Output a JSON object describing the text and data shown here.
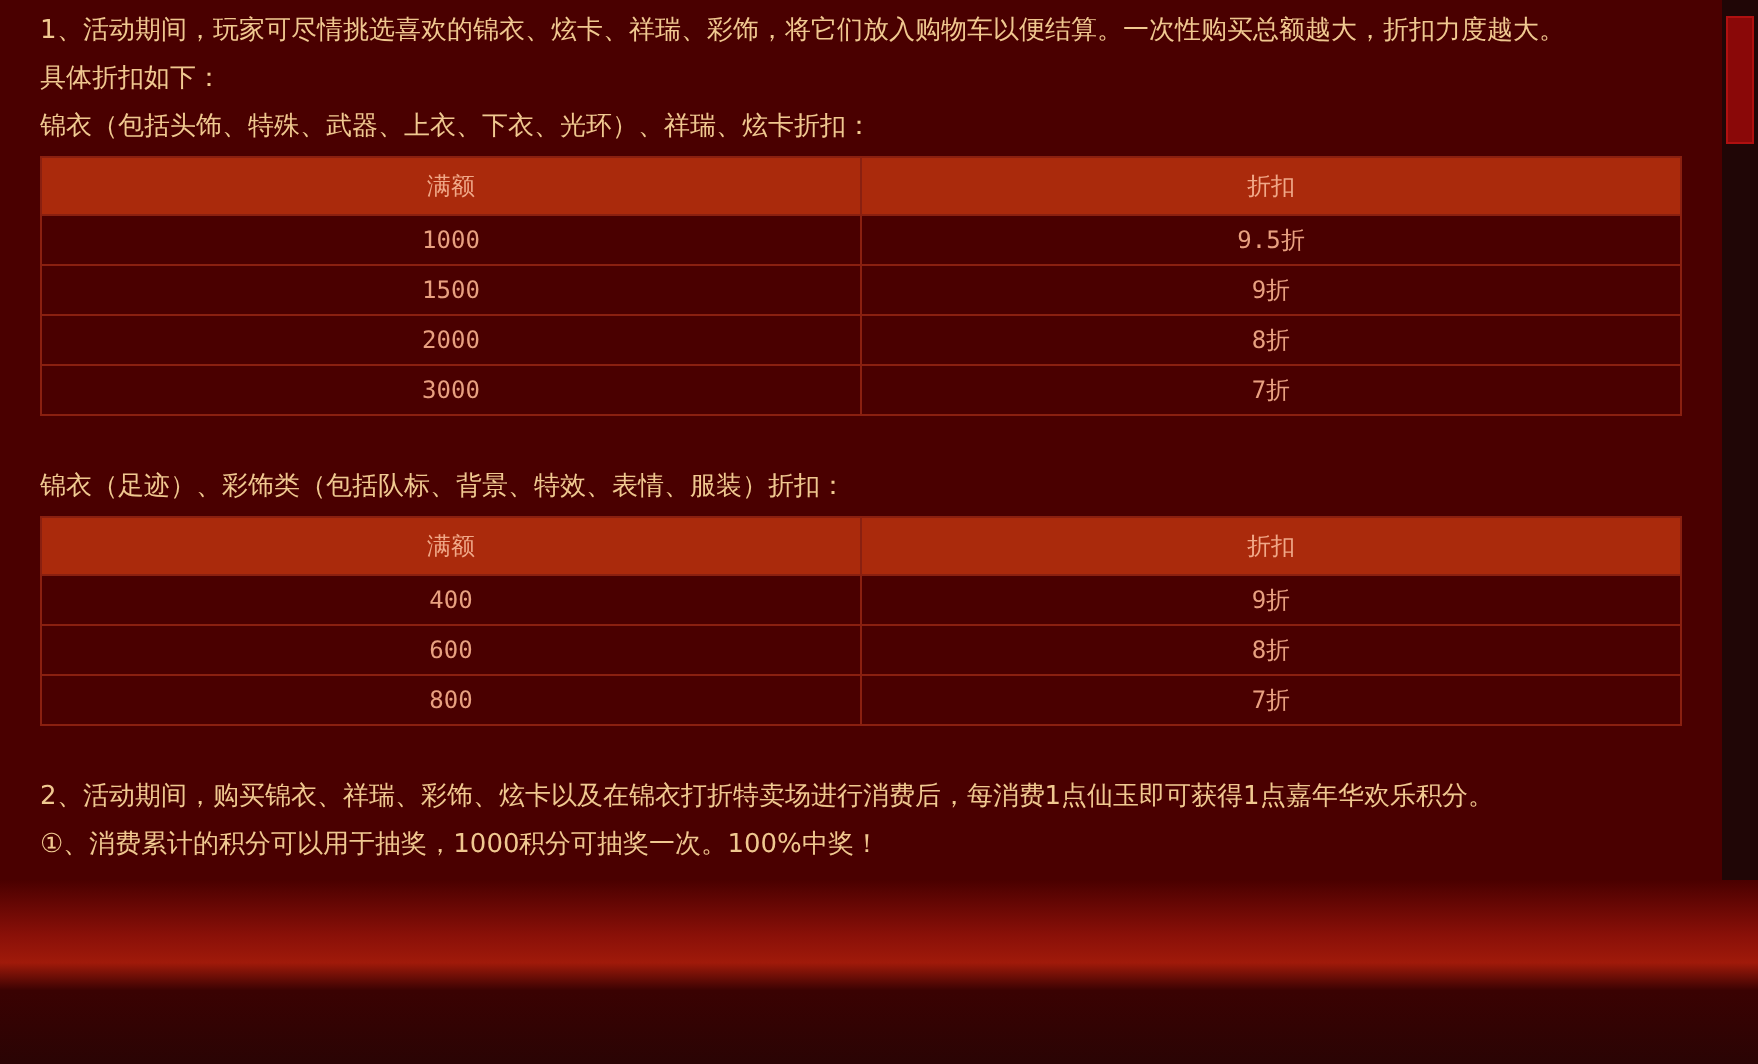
{
  "intro": [
    "1、活动期间，玩家可尽情挑选喜欢的锦衣、炫卡、祥瑞、彩饰，将它们放入购物车以便结算。一次性购买总额越大，折扣力度越大。",
    "具体折扣如下："
  ],
  "sections": [
    {
      "heading": "锦衣（包括头饰、特殊、武器、上衣、下衣、光环）、祥瑞、炫卡折扣：",
      "columns": [
        "满额",
        "折扣"
      ],
      "rows": [
        [
          "1000",
          "9.5折"
        ],
        [
          "1500",
          "9折"
        ],
        [
          "2000",
          "8折"
        ],
        [
          "3000",
          "7折"
        ]
      ]
    },
    {
      "heading": "锦衣（足迹）、彩饰类（包括队标、背景、特效、表情、服装）折扣：",
      "columns": [
        "满额",
        "折扣"
      ],
      "rows": [
        [
          "400",
          "9折"
        ],
        [
          "600",
          "8折"
        ],
        [
          "800",
          "7折"
        ]
      ]
    }
  ],
  "outro": [
    "2、活动期间，购买锦衣、祥瑞、彩饰、炫卡以及在锦衣打折特卖场进行消费后，每消费1点仙玉即可获得1点嘉年华欢乐积分。",
    "①、消费累计的积分可以用于抽奖，1000积分可抽奖一次。100%中奖！"
  ]
}
